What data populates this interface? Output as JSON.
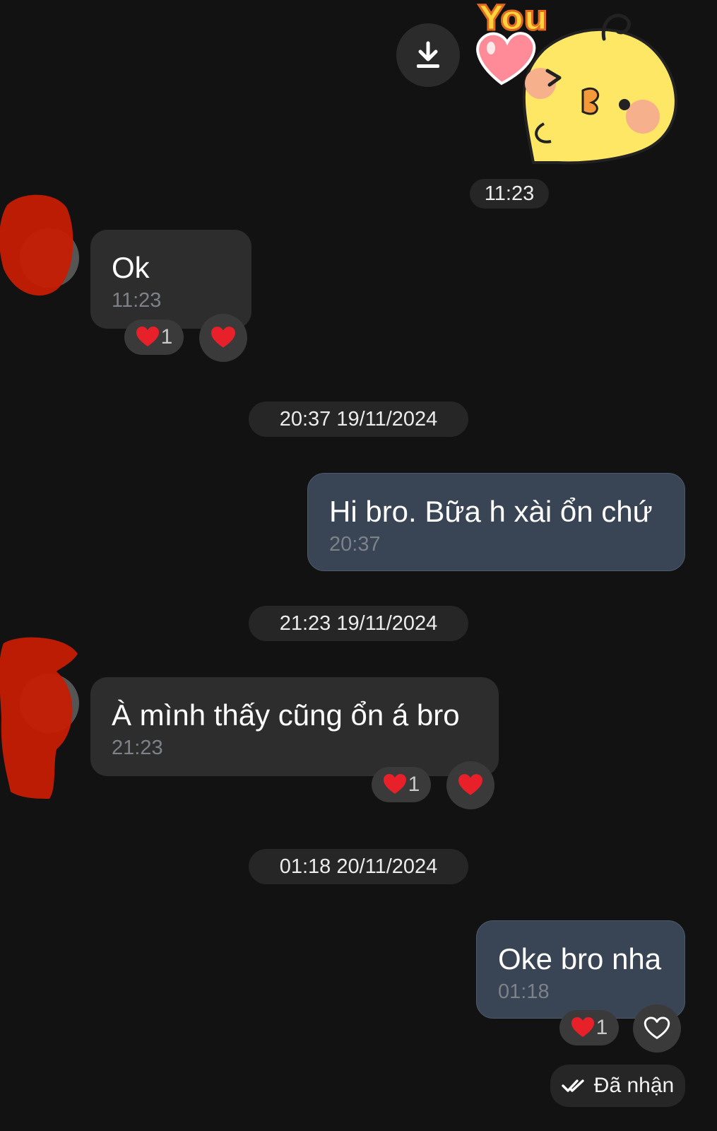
{
  "sticker": {
    "icon": "love-you-chick-sticker",
    "text": "You",
    "download_icon": "download-icon"
  },
  "messages": [
    {
      "kind": "time-pill",
      "label": "11:23"
    },
    {
      "kind": "incoming",
      "text": "Ok",
      "time": "11:23",
      "reaction_count": "1",
      "reaction_icon": "heart-icon"
    },
    {
      "kind": "time-pill",
      "label": "20:37 19/11/2024"
    },
    {
      "kind": "outgoing",
      "text": "Hi bro. Bữa h xài ổn chứ",
      "time": "20:37"
    },
    {
      "kind": "time-pill",
      "label": "21:23 19/11/2024"
    },
    {
      "kind": "incoming",
      "text": "À mình thấy cũng ổn á bro",
      "time": "21:23",
      "reaction_count": "1",
      "reaction_icon": "heart-icon"
    },
    {
      "kind": "time-pill",
      "label": "01:18 20/11/2024"
    },
    {
      "kind": "outgoing",
      "text": "Oke bro nha",
      "time": "01:18",
      "reaction_count": "1",
      "reaction_icon": "heart-outline-icon"
    }
  ],
  "status": {
    "label": "Đã nhận",
    "icon": "double-check-icon"
  },
  "colors": {
    "background": "#121212",
    "incoming_bubble": "#2d2d2d",
    "outgoing_bubble": "#394554",
    "heart": "#e8202a",
    "avatar_redaction": "#c61c04"
  }
}
